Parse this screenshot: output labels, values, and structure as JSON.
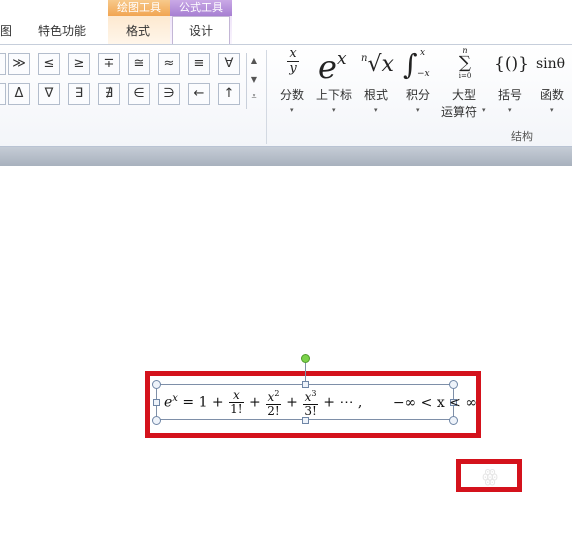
{
  "tabs": {
    "partial_left": "图",
    "special": "特色功能",
    "drawing_tools_title": "绘图工具",
    "formula_tools_title": "公式工具",
    "format": "格式",
    "design": "设计"
  },
  "symbols": {
    "row1": [
      "≫",
      "≤",
      "≥",
      "∓",
      "≅",
      "≈",
      "≡",
      "∀"
    ],
    "row2": [
      "Δ",
      "∇",
      "∃",
      "∄",
      "∈",
      "∋",
      "←",
      "↑"
    ],
    "row1_partial": "",
    "row2_partial": "",
    "scroll_up": "▲",
    "scroll_down": "▼",
    "more": "⩡"
  },
  "structures": {
    "items": [
      {
        "label": "分数",
        "icon_top": "x",
        "icon_bottom": "y"
      },
      {
        "label": "上下标",
        "icon_base": "e",
        "icon_sup": "x"
      },
      {
        "label": "根式",
        "icon_index": "n",
        "icon_radical": "√",
        "icon_body": "x"
      },
      {
        "label": "积分",
        "icon_sign": "∫",
        "icon_upper": "x",
        "icon_lower": "−x"
      },
      {
        "label": "大型",
        "label2": "运算符",
        "icon_sign": "∑",
        "icon_upper": "n",
        "icon_lower": "i=0"
      },
      {
        "label": "括号",
        "icon": "{()}"
      },
      {
        "label": "函数",
        "icon": "sinθ"
      }
    ],
    "dropdown_glyph": "▾",
    "group_label": "结构"
  },
  "equation": {
    "lhs_base": "e",
    "lhs_sup": "x",
    "eq_one_plus": "= 1 +",
    "f1_num": "x",
    "f1_den": "1!",
    "plus1": "+",
    "f2_num": "x",
    "f2_num_sup": "2",
    "f2_den": "2!",
    "plus2": "+",
    "f3_num": "x",
    "f3_num_sup": "3",
    "f3_den": "3!",
    "tail": "+ ⋯ ,",
    "range": "−∞ < x < ∞"
  },
  "colors": {
    "highlight_red": "#d4121c",
    "drawing_tools": "#f1a552",
    "formula_tools": "#a77fd2",
    "rotate_handle": "#7bd24a"
  }
}
